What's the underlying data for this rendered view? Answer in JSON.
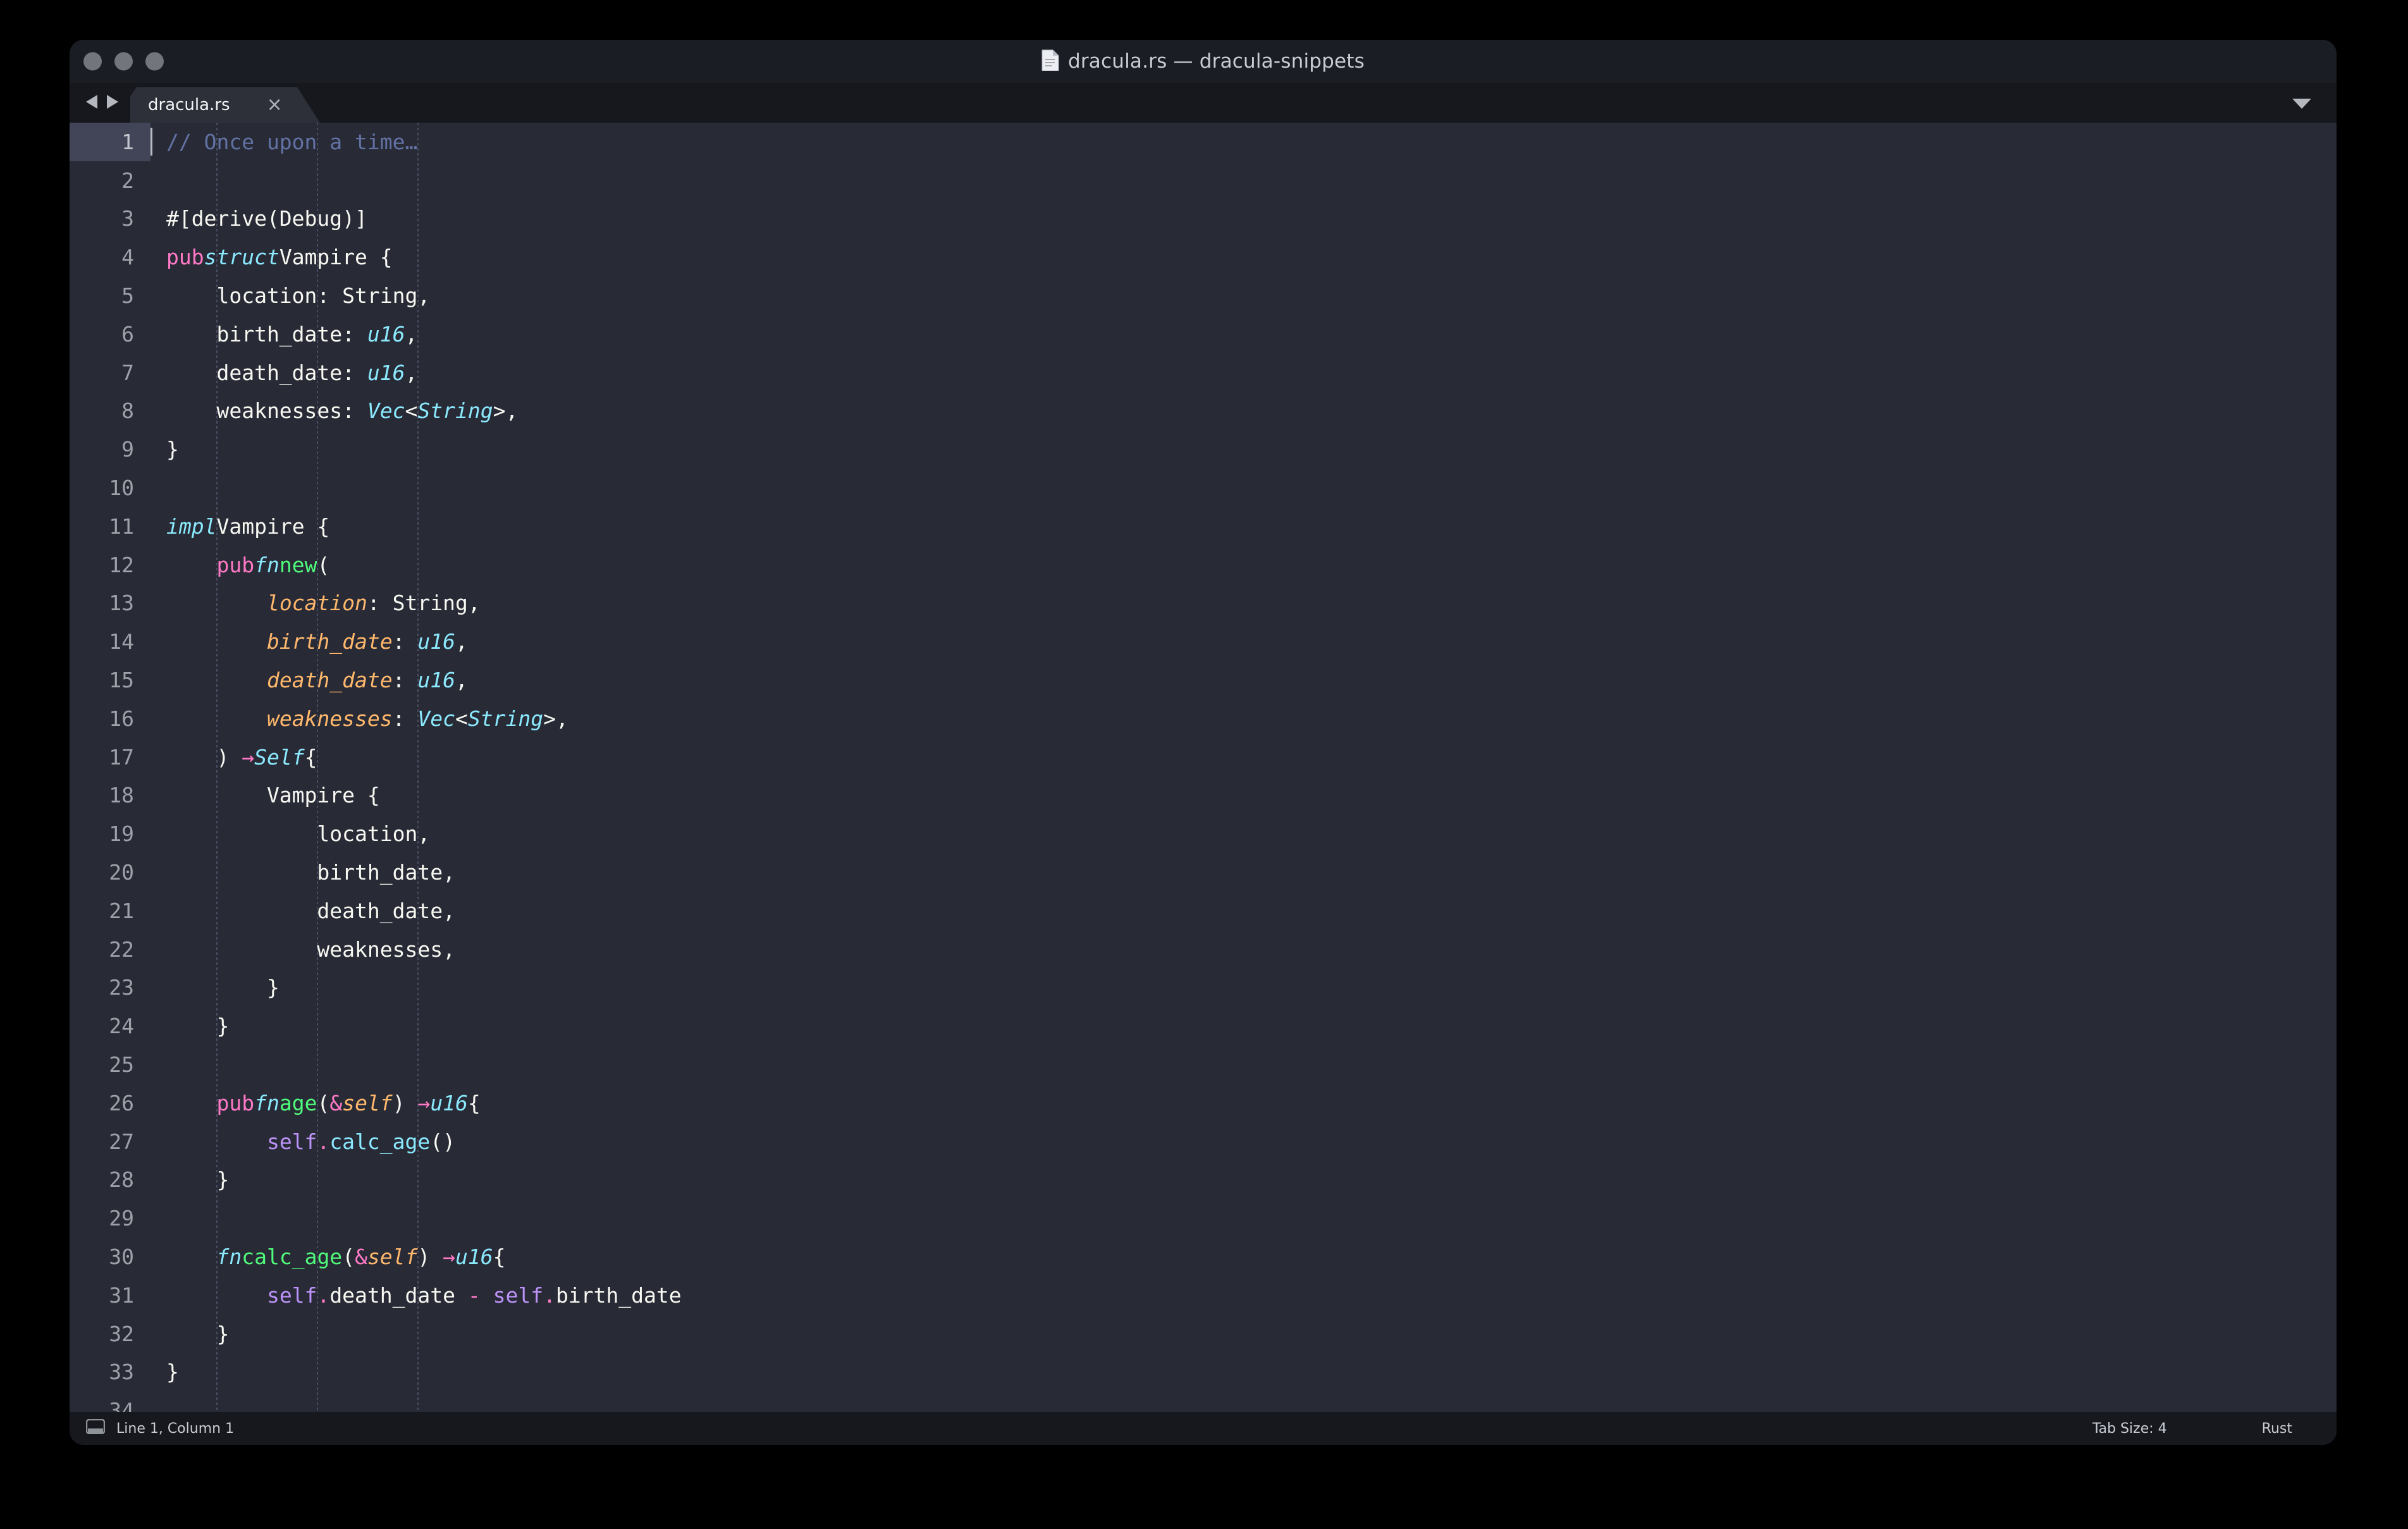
{
  "window": {
    "title": "dracula.rs — dracula-snippets",
    "doc_icon": "document-icon",
    "traffic_lights": [
      "close-button",
      "minimize-button",
      "maximize-button"
    ]
  },
  "tabbar": {
    "nav_back_icon": "nav-back-icon",
    "nav_forward_icon": "nav-forward-icon",
    "overflow_icon": "chevron-down-icon",
    "tabs": [
      {
        "label": "dracula.rs",
        "close_label": "×",
        "active": true
      }
    ]
  },
  "statusbar": {
    "panel_icon": "panel-toggle-icon",
    "cursor_position": "Line 1, Column 1",
    "tab_size": "Tab Size: 4",
    "syntax": "Rust"
  },
  "editor": {
    "language": "Rust",
    "total_lines": 34,
    "active_line": 1,
    "colors": {
      "background": "#282a36",
      "foreground": "#f8f8f2",
      "comment": "#6272a4",
      "keyword": "#ff79c6",
      "type": "#8be9fd",
      "function": "#50fa7b",
      "parameter": "#ffb86c",
      "variable": "#bd93f9",
      "gutter": "#9ea1a8",
      "active_line": "#424557"
    },
    "lines": [
      {
        "n": 1,
        "indent": 0,
        "text": "// Once upon a time…"
      },
      {
        "n": 2,
        "indent": 0,
        "text": ""
      },
      {
        "n": 3,
        "indent": 0,
        "text": "#[derive(Debug)]"
      },
      {
        "n": 4,
        "indent": 0,
        "text": "pub struct Vampire {"
      },
      {
        "n": 5,
        "indent": 1,
        "text": "location: String,"
      },
      {
        "n": 6,
        "indent": 1,
        "text": "birth_date: u16,"
      },
      {
        "n": 7,
        "indent": 1,
        "text": "death_date: u16,"
      },
      {
        "n": 8,
        "indent": 1,
        "text": "weaknesses: Vec<String>,"
      },
      {
        "n": 9,
        "indent": 0,
        "text": "}"
      },
      {
        "n": 10,
        "indent": 0,
        "text": ""
      },
      {
        "n": 11,
        "indent": 0,
        "text": "impl Vampire {"
      },
      {
        "n": 12,
        "indent": 1,
        "text": "pub fn new("
      },
      {
        "n": 13,
        "indent": 2,
        "text": "location: String,"
      },
      {
        "n": 14,
        "indent": 2,
        "text": "birth_date: u16,"
      },
      {
        "n": 15,
        "indent": 2,
        "text": "death_date: u16,"
      },
      {
        "n": 16,
        "indent": 2,
        "text": "weaknesses: Vec<String>,"
      },
      {
        "n": 17,
        "indent": 1,
        "text": ") → Self {"
      },
      {
        "n": 18,
        "indent": 2,
        "text": "Vampire {"
      },
      {
        "n": 19,
        "indent": 3,
        "text": "location,"
      },
      {
        "n": 20,
        "indent": 3,
        "text": "birth_date,"
      },
      {
        "n": 21,
        "indent": 3,
        "text": "death_date,"
      },
      {
        "n": 22,
        "indent": 3,
        "text": "weaknesses,"
      },
      {
        "n": 23,
        "indent": 2,
        "text": "}"
      },
      {
        "n": 24,
        "indent": 1,
        "text": "}"
      },
      {
        "n": 25,
        "indent": 0,
        "text": ""
      },
      {
        "n": 26,
        "indent": 1,
        "text": "pub fn age(&self) → u16 {"
      },
      {
        "n": 27,
        "indent": 2,
        "text": "self.calc_age()"
      },
      {
        "n": 28,
        "indent": 1,
        "text": "}"
      },
      {
        "n": 29,
        "indent": 0,
        "text": ""
      },
      {
        "n": 30,
        "indent": 1,
        "text": "fn calc_age(&self) → u16 {"
      },
      {
        "n": 31,
        "indent": 2,
        "text": "self.death_date - self.birth_date"
      },
      {
        "n": 32,
        "indent": 1,
        "text": "}"
      },
      {
        "n": 33,
        "indent": 0,
        "text": "}"
      },
      {
        "n": 34,
        "indent": 0,
        "text": ""
      }
    ]
  }
}
